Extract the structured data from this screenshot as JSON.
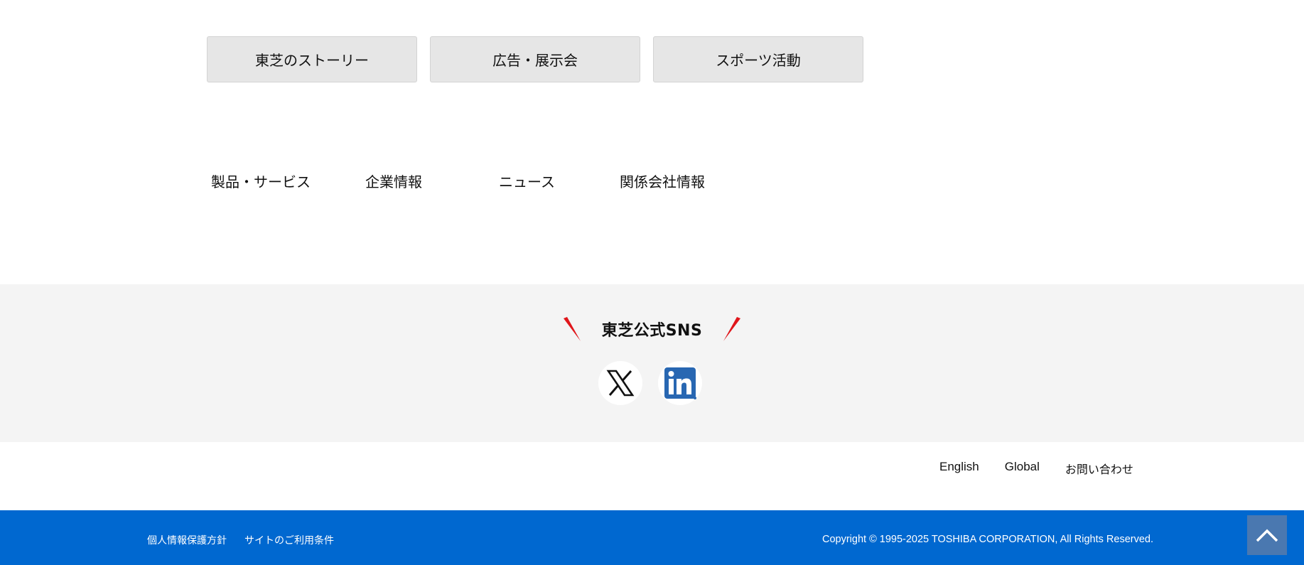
{
  "top_buttons": {
    "story": "東芝のストーリー",
    "ads": "広告・展示会",
    "sports": "スポーツ活動"
  },
  "category_nav": {
    "products": "製品・サービス",
    "company": "企業情報",
    "news": "ニュース",
    "affiliates": "関係会社情報"
  },
  "sns": {
    "title": "東芝公式SNS",
    "icons": [
      "x-logo-icon",
      "linkedin-logo-icon"
    ],
    "accent_color": "#e0161b"
  },
  "utility_links": {
    "english": "English",
    "global": "Global",
    "contact": "お問い合わせ"
  },
  "footer": {
    "privacy": "個人情報保護方針",
    "terms": "サイトのご利用条件",
    "copyright": "Copyright © 1995-2025 TOSHIBA CORPORATION, All Rights Reserved.",
    "background_color": "#0068d0",
    "back_to_top_icon": "chevron-up-icon"
  }
}
